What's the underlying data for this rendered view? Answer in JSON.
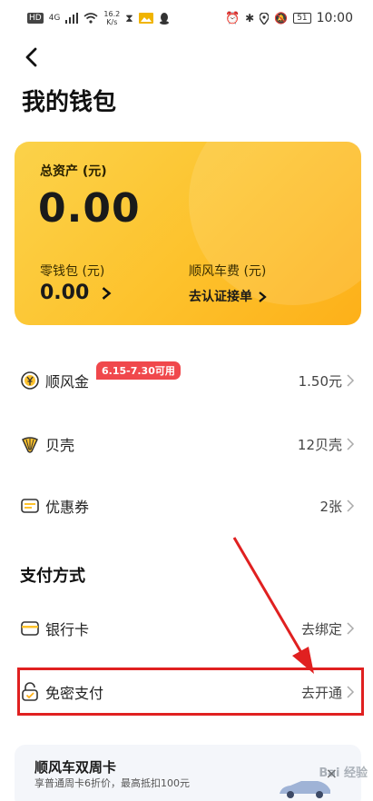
{
  "status_bar": {
    "hd": "HD",
    "network": "4G",
    "speed_value": "16.2",
    "speed_unit": "K/s",
    "battery": "51",
    "time": "10:00"
  },
  "page": {
    "title": "我的钱包"
  },
  "assets": {
    "total_label": "总资产 (元)",
    "total_value": "0.00",
    "change_label": "零钱包 (元)",
    "change_value": "0.00",
    "ride_label": "顺风车费 (元)",
    "ride_link": "去认证接单"
  },
  "list": [
    {
      "label": "顺风金",
      "badge": "6.15-7.30可用",
      "value": "1.50元",
      "icon": "yen-coin-icon"
    },
    {
      "label": "贝壳",
      "value": "12贝壳",
      "icon": "shell-icon"
    },
    {
      "label": "优惠券",
      "value": "2张",
      "icon": "coupon-icon"
    }
  ],
  "payment": {
    "title": "支付方式",
    "items": [
      {
        "label": "银行卡",
        "value": "去绑定",
        "icon": "bank-card-icon"
      },
      {
        "label": "免密支付",
        "value": "去开通",
        "icon": "lock-check-icon"
      }
    ]
  },
  "promo": {
    "title": "顺风车双周卡",
    "subtitle": "享普通周卡6折价，最高抵扣100元",
    "close": "×"
  },
  "watermark": "Bai 经验",
  "colors": {
    "card_start": "#fbd24a",
    "card_end": "#fdb019",
    "badge": "#f0484c",
    "highlight": "#e02020"
  }
}
